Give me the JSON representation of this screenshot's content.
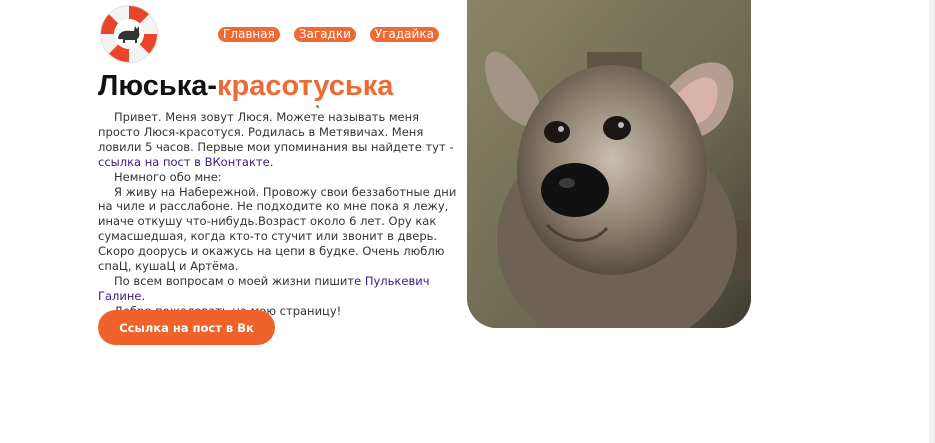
{
  "header": {
    "logo_icon": "lifebuoy-cat-icon",
    "nav": [
      {
        "label": "Главная"
      },
      {
        "label": "Загадки"
      },
      {
        "label": "Угадайка"
      }
    ]
  },
  "main": {
    "title_part1": "Люська-",
    "title_part2": "красотуська",
    "paragraphs": [
      {
        "before": "Привет. Меня зовут Люся. Можете называть меня просто Люся-красотуся. Родилась в Метявичах. Меня ловили 5 часов. Первые мои упоминания вы найдете тут - ",
        "link": "ссылка на пост в ВКонтакте",
        "after": "."
      },
      {
        "text": "Немного обо мне:"
      },
      {
        "text": "Я живу на Набережной. Провожу свои беззаботные дни на чиле и расслабоне. Не подходите ко мне пока я лежу, иначе откушу что-нибудь.Возраст около 6 лет. Ору как сумасшедшая, когда кто-то стучит или звонит в дверь. Скоро доорусь и окажусь на цепи в будке. Очень люблю спаЦ, кушаЦ и Артёма."
      },
      {
        "before": "По всем вопросам о моей жизни пишите ",
        "link": "Пулькевич Галине",
        "after": "."
      },
      {
        "text": "Добро пожаловать на мою страницу!"
      }
    ],
    "cta_label": "Ссылка на пост в Вк"
  },
  "photo": {
    "subject": "dog-photo"
  },
  "colors": {
    "accent": "#ee6a34",
    "link": "#3a1a7e",
    "text": "#333333"
  }
}
